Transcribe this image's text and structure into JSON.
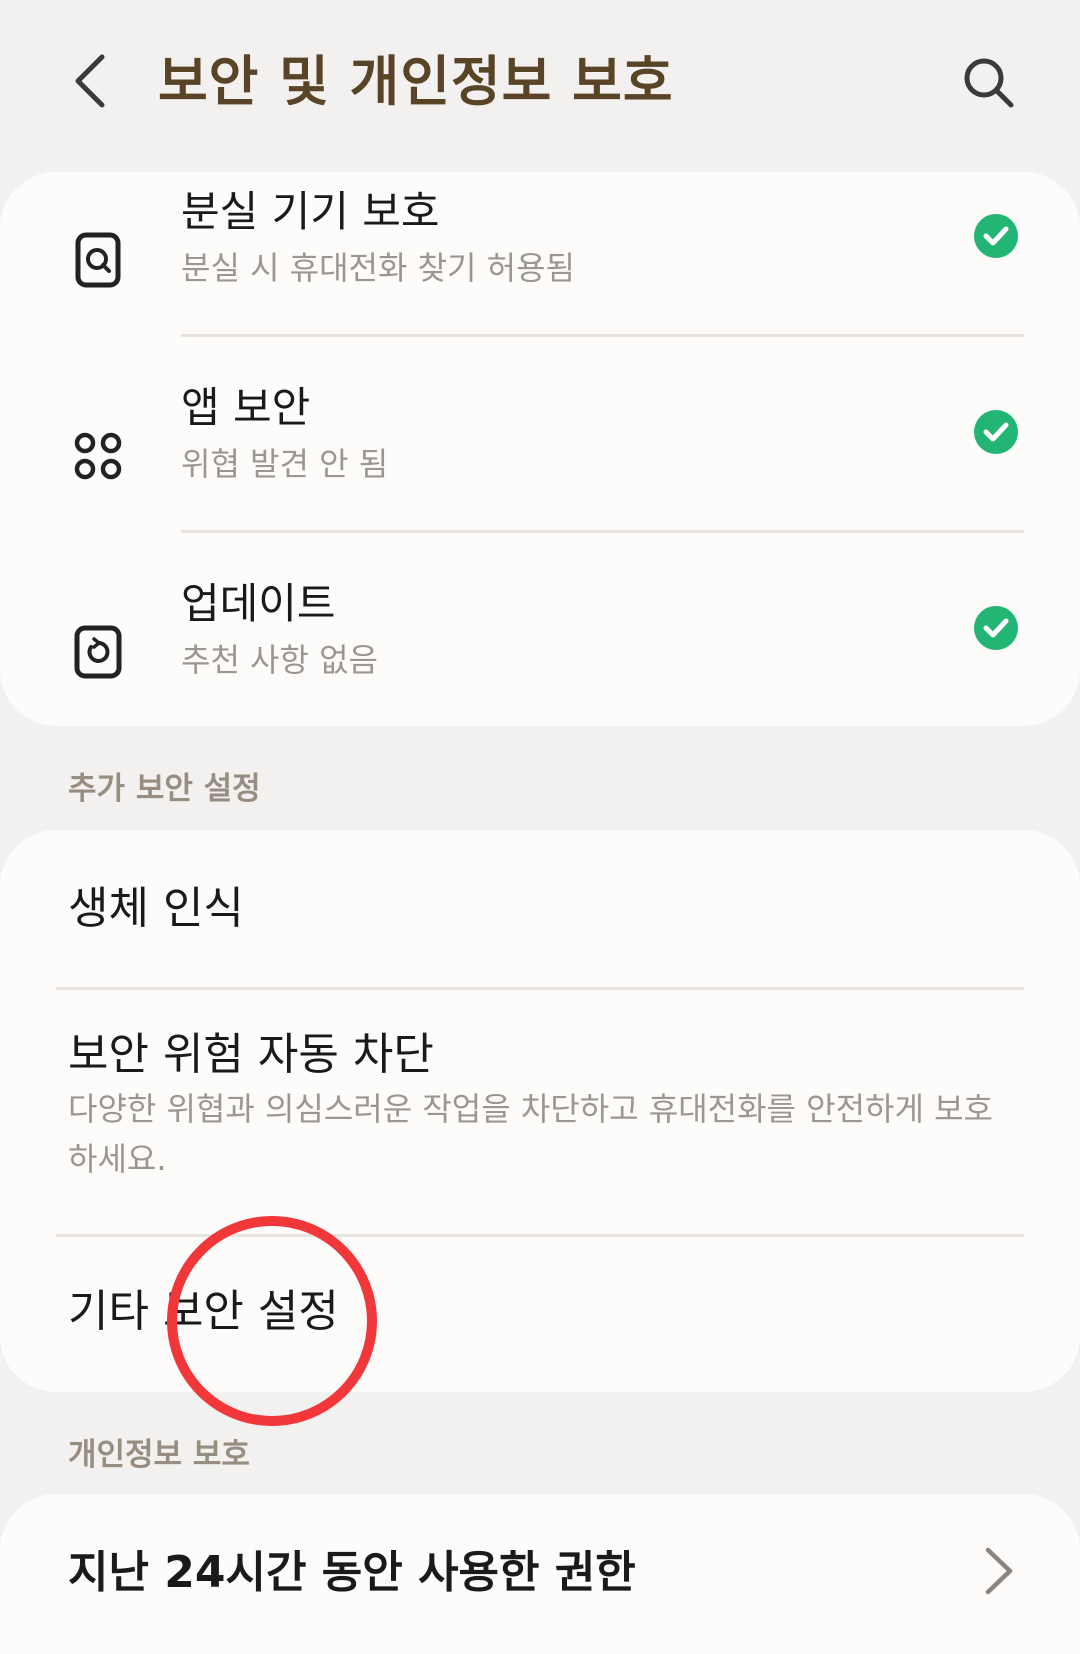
{
  "header": {
    "title": "보안 및 개인정보 보호"
  },
  "status_items": [
    {
      "title": "분실 기기 보호",
      "subtitle": "분실 시 휴대전화 찾기 허용됨"
    },
    {
      "title": "앱 보안",
      "subtitle": "위협 발견 안 됨"
    },
    {
      "title": "업데이트",
      "subtitle": "추천 사항 없음"
    }
  ],
  "sections": {
    "additional_security": {
      "header": "추가 보안 설정",
      "items": [
        {
          "title": "생체 인식"
        },
        {
          "title": "보안 위험 자동 차단",
          "description": "다양한 위협과 의심스러운 작업을 차단하고 휴대전화를 안전하게 보호하세요."
        },
        {
          "title": "기타 보안 설정"
        }
      ]
    },
    "privacy": {
      "header": "개인정보 보호",
      "items": [
        {
          "title": "지난 24시간 동안 사용한 권한"
        }
      ]
    }
  },
  "colors": {
    "accent_title": "#5a4427",
    "status_ok": "#22b573",
    "annotation": "#f2373a"
  }
}
